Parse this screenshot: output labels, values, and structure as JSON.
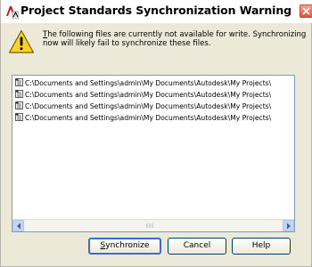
{
  "window": {
    "title": "Project Standards Synchronization Warning",
    "app_icon": "autocad-icon",
    "close_icon": "close-icon"
  },
  "message": {
    "icon": "warning-icon",
    "accel": "T",
    "text_rest": "he following files are currently not available for write. Synchronizing now will likely fail to synchronize these files."
  },
  "files": [
    "C:\\Documents and Settings\\admin\\My Documents\\Autodesk\\My Projects\\",
    "C:\\Documents and Settings\\admin\\My Documents\\Autodesk\\My Projects\\",
    "C:\\Documents and Settings\\admin\\My Documents\\Autodesk\\My Projects\\",
    "C:\\Documents and Settings\\admin\\My Documents\\Autodesk\\My Projects\\"
  ],
  "file_icon": "file-icon",
  "scrollbar": {
    "left_icon": "arrow-left-icon",
    "right_icon": "arrow-right-icon"
  },
  "buttons": {
    "synchronize_accel": "S",
    "synchronize_rest": "ynchronize",
    "cancel": "Cancel",
    "help": "Help"
  }
}
